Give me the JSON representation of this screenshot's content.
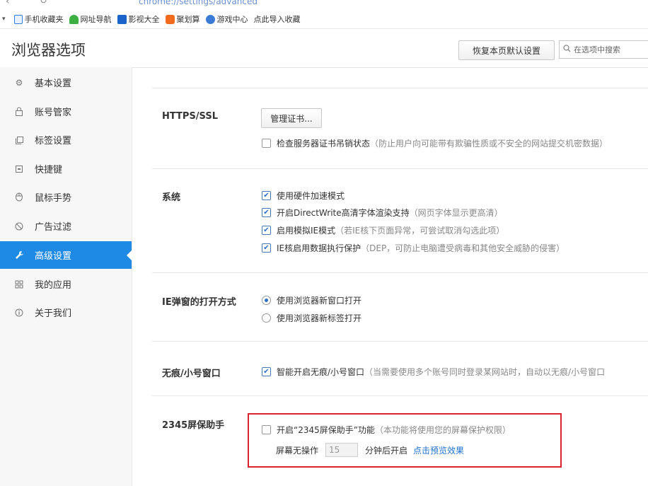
{
  "browser": {
    "address_fragment": "chrome://settings/advanced"
  },
  "bookmarks": [
    {
      "label": "手机收藏夹",
      "icon": "mobile-bookmark-icon",
      "color": "#2f7fe0"
    },
    {
      "label": "网址导航",
      "icon": "nav-icon",
      "color": "#3cb043"
    },
    {
      "label": "影视大全",
      "icon": "video-icon",
      "color": "#1b63c9"
    },
    {
      "label": "聚划算",
      "icon": "juhuasuan-icon",
      "color": "#f26b1d"
    },
    {
      "label": "游戏中心",
      "icon": "game-icon",
      "color": "#3a7bd5"
    },
    {
      "label": "点此导入收藏",
      "icon": "",
      "color": ""
    }
  ],
  "header": {
    "title": "浏览器选项",
    "reset_label": "恢复本页默认设置",
    "search_placeholder": "在选项中搜索"
  },
  "sidebar": {
    "items": [
      {
        "label": "基本设置",
        "icon": "gear-icon",
        "active": false
      },
      {
        "label": "账号管家",
        "icon": "lock-icon",
        "active": false
      },
      {
        "label": "标签设置",
        "icon": "tabs-icon",
        "active": false
      },
      {
        "label": "快捷键",
        "icon": "keyboard-icon",
        "active": false
      },
      {
        "label": "鼠标手势",
        "icon": "mouse-icon",
        "active": false
      },
      {
        "label": "广告过滤",
        "icon": "block-icon",
        "active": false
      },
      {
        "label": "高级设置",
        "icon": "wrench-icon",
        "active": true
      },
      {
        "label": "我的应用",
        "icon": "apps-icon",
        "active": false
      },
      {
        "label": "关于我们",
        "icon": "info-icon",
        "active": false
      }
    ]
  },
  "sections": {
    "https": {
      "title": "HTTPS/SSL",
      "manage_cert_label": "管理证书...",
      "check_revocation": {
        "label": "检查服务器证书吊销状态",
        "hint": "（防止用户向可能带有欺骗性质或不安全的网站提交机密数据）",
        "checked": false
      }
    },
    "system": {
      "title": "系统",
      "options": [
        {
          "label": "使用硬件加速模式",
          "hint": "",
          "checked": true
        },
        {
          "label": "开启DirectWrite高清字体渲染支持",
          "hint": "（网页字体显示更高清）",
          "checked": true
        },
        {
          "label": "启用模拟IE模式",
          "hint": "（若IE核下页面异常，可尝试取消勾选此项）",
          "checked": true
        },
        {
          "label": "IE核启用数据执行保护",
          "hint": "（DEP，可防止电脑遭受病毒和其他安全威胁的侵害）",
          "checked": true
        }
      ]
    },
    "ie_popup": {
      "title": "IE弹窗的打开方式",
      "options": [
        {
          "label": "使用浏览器新窗口打开",
          "selected": true
        },
        {
          "label": "使用浏览器新标签打开",
          "selected": false
        }
      ]
    },
    "incognito": {
      "title": "无痕/小号窗口",
      "option": {
        "label": "智能开启无痕/小号窗口",
        "hint": "（当需要使用多个账号同时登录某网站时，自动以无痕/小号窗口",
        "checked": true
      }
    },
    "screensaver": {
      "title": "2345屏保助手",
      "enable": {
        "label": "开启“2345屏保助手”功能",
        "hint": "（本功能将使用您的屏幕保护权限）",
        "checked": false
      },
      "idle_label": "屏幕无操作",
      "idle_minutes": "15",
      "after_label": "分钟后开启",
      "preview_link": "点击预览效果"
    }
  },
  "colors": {
    "accent": "#1f8ae5",
    "highlight_box": "#d9232d",
    "link": "#1f6fd0"
  }
}
